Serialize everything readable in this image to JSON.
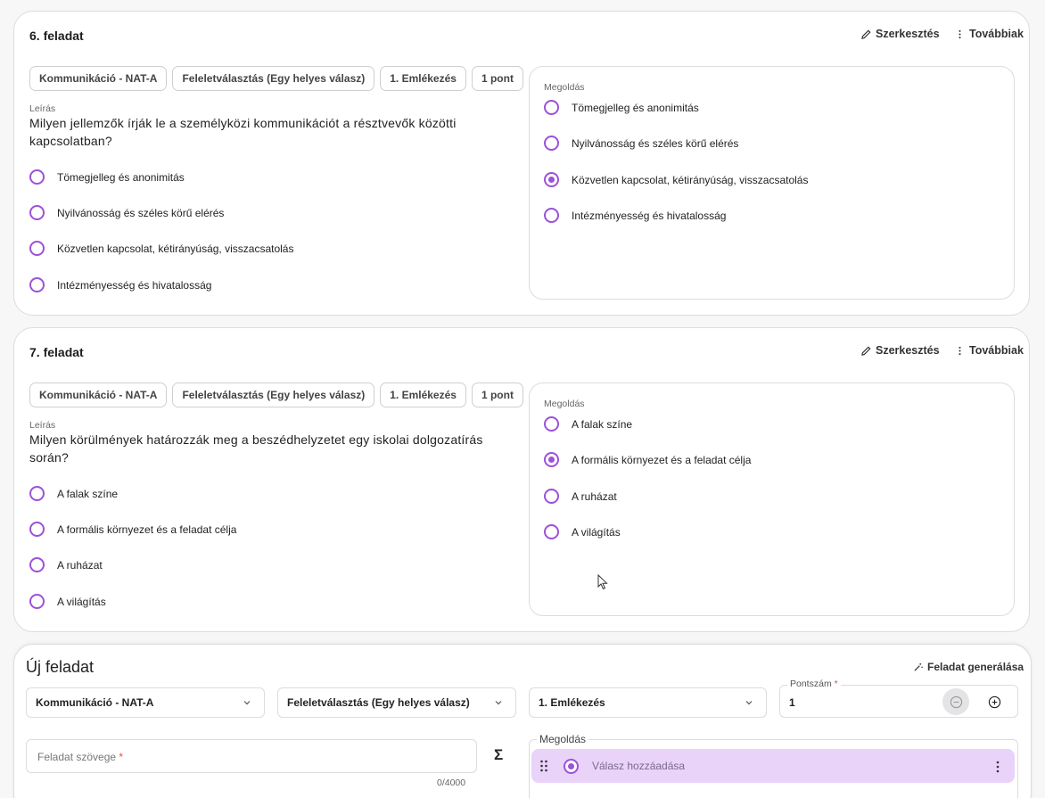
{
  "task6": {
    "title": "6. feladat",
    "edit_label": "Szerkesztés",
    "more_label": "Továbbiak",
    "chips": [
      "Kommunikáció - NAT-A",
      "Feleletválasztás (Egy helyes válasz)",
      "1. Emlékezés",
      "1 pont"
    ],
    "description_label": "Leírás",
    "question": "Milyen jellemzők írják le a személyközi kommunikációt a résztvevők közötti kapcsolatban?",
    "options": [
      "Tömegjelleg és anonimitás",
      "Nyilvánosság és széles körű elérés",
      "Közvetlen kapcsolat, kétirányúság, visszacsatolás",
      "Intézményesség és hivatalosság"
    ],
    "solution_label": "Megoldás",
    "solution_options": [
      "Tömegjelleg és anonimitás",
      "Nyilvánosság és széles körű elérés",
      "Közvetlen kapcsolat, kétirányúság, visszacsatolás",
      "Intézményesség és hivatalosság"
    ],
    "correct_index": 2
  },
  "task7": {
    "title": "7. feladat",
    "edit_label": "Szerkesztés",
    "more_label": "Továbbiak",
    "chips": [
      "Kommunikáció - NAT-A",
      "Feleletválasztás (Egy helyes válasz)",
      "1. Emlékezés",
      "1 pont"
    ],
    "description_label": "Leírás",
    "question": "Milyen körülmények határozzák meg a beszédhelyzetet egy iskolai dolgozatírás során?",
    "options": [
      "A falak színe",
      "A formális környezet és a feladat célja",
      "A ruházat",
      "A világítás"
    ],
    "solution_label": "Megoldás",
    "solution_options": [
      "A falak színe",
      "A formális környezet és a feladat célja",
      "A ruházat",
      "A világítás"
    ],
    "correct_index": 1
  },
  "new_task": {
    "title": "Új feladat",
    "generate_label": "Feladat generálása",
    "subject_value": "Kommunikáció - NAT-A",
    "type_value": "Feleletválasztás (Egy helyes válasz)",
    "level_value": "1. Emlékezés",
    "points_label": "Pontszám",
    "points_value": "1",
    "required_mark": "*",
    "text_placeholder": "Feladat szövege",
    "char_counter": "0/4000",
    "sigma": "Σ",
    "solution_label": "Megoldás",
    "add_answer": "Válasz hozzáadása"
  },
  "colors": {
    "accent": "#9c52d8",
    "answer_bg": "#e9d3f9"
  }
}
